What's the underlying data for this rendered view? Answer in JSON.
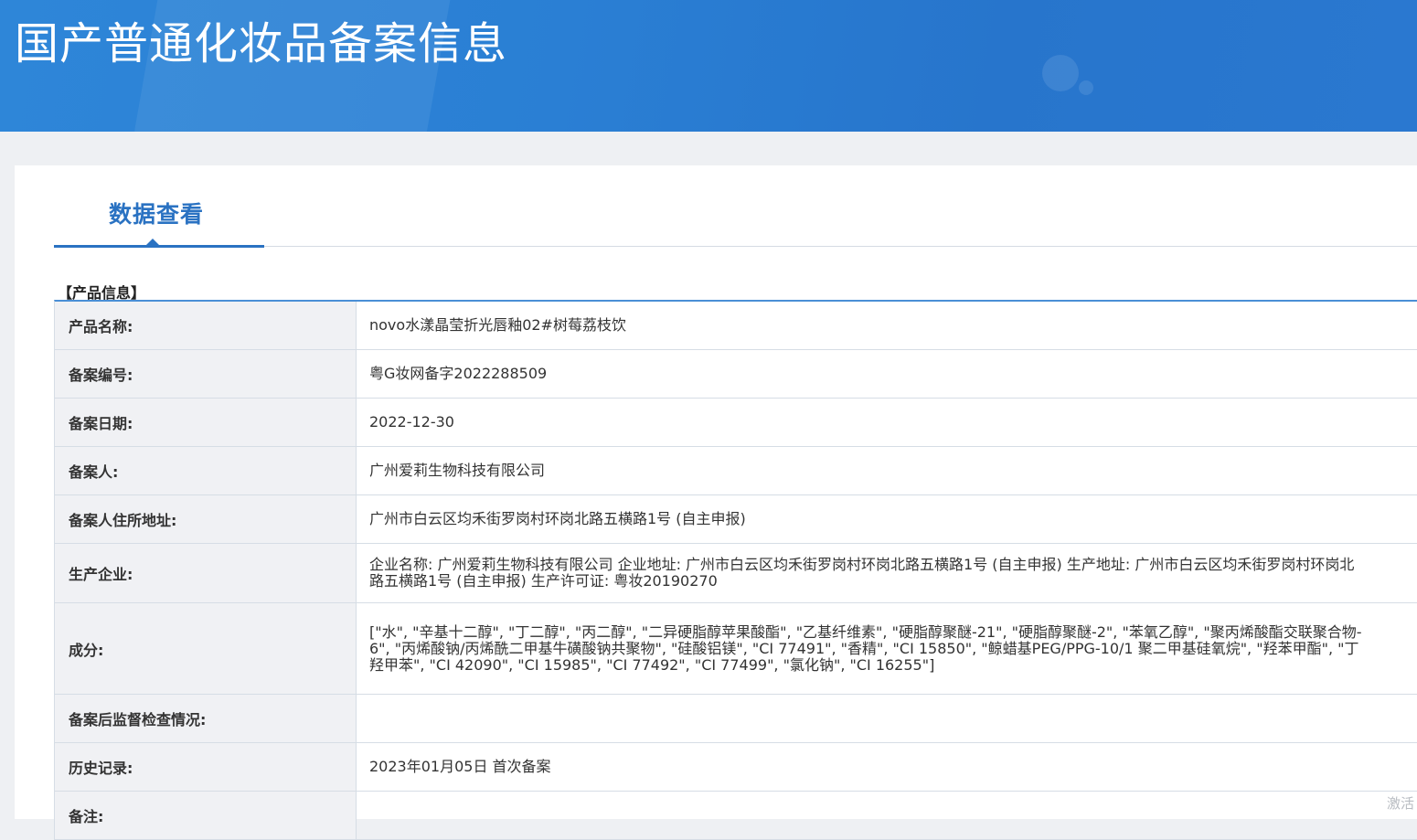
{
  "banner": {
    "title": "国产普通化妆品备案信息"
  },
  "tab": {
    "label": "数据查看"
  },
  "section": {
    "title": "【产品信息】"
  },
  "rows": [
    {
      "label": "产品名称:",
      "value": "novo水漾晶莹折光唇釉02#树莓荔枝饮"
    },
    {
      "label": "备案编号:",
      "value": "粤G妆网备字2022288509"
    },
    {
      "label": "备案日期:",
      "value": "2022-12-30"
    },
    {
      "label": "备案人:",
      "value": "广州爱莉生物科技有限公司"
    },
    {
      "label": "备案人住所地址:",
      "value": "广州市白云区均禾街罗岗村环岗北路五横路1号 (自主申报)"
    },
    {
      "label": "生产企业:",
      "value": "企业名称: 广州爱莉生物科技有限公司 企业地址: 广州市白云区均禾街罗岗村环岗北路五横路1号 (自主申报)  生产地址: 广州市白云区均禾街罗岗村环岗北路五横路1号 (自主申报)  生产许可证: 粤妆20190270"
    },
    {
      "label": "成分:",
      "value": "[\"水\", \"辛基十二醇\", \"丁二醇\", \"丙二醇\", \"二异硬脂醇苹果酸酯\", \"乙基纤维素\", \"硬脂醇聚醚-21\", \"硬脂醇聚醚-2\", \"苯氧乙醇\", \"聚丙烯酸酯交联聚合物-6\", \"丙烯酸钠/丙烯酰二甲基牛磺酸钠共聚物\", \"硅酸铝镁\", \"CI 77491\", \"香精\", \"CI 15850\", \"鲸蜡基PEG/PPG-10/1 聚二甲基硅氧烷\", \"羟苯甲酯\", \"丁羟甲苯\", \"CI 42090\", \"CI 15985\", \"CI 77492\", \"CI 77499\", \"氯化钠\", \"CI 16255\"]"
    },
    {
      "label": "备案后监督检查情况:",
      "value": ""
    },
    {
      "label": "历史记录:",
      "value": "2023年01月05日 首次备案"
    },
    {
      "label": "备注:",
      "value": ""
    }
  ],
  "watermark": "激活"
}
